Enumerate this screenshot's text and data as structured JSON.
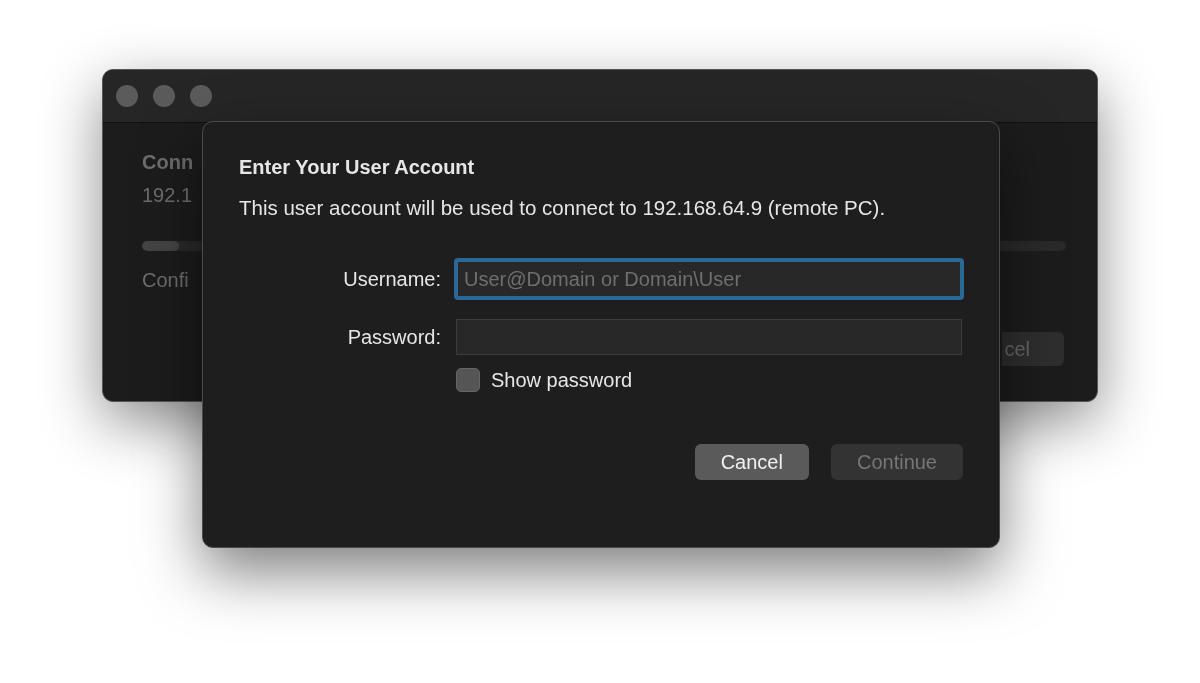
{
  "background_window": {
    "heading": "Conn",
    "subtitle": "192.1",
    "progress": {
      "level": 0.04
    },
    "status": "Confi",
    "button": "cel"
  },
  "dialog": {
    "title": "Enter Your User Account",
    "message": "This user account will be used to connect to 192.168.64.9 (remote PC).",
    "fields": [
      {
        "label": "Username:",
        "placeholder": "User@Domain or Domain\\User",
        "focused": true
      },
      {
        "label": "Password:",
        "focused": false
      }
    ],
    "show_password": {
      "label": "Show password",
      "checked": false
    },
    "buttons": [
      {
        "label": "Cancel",
        "disabled": false
      },
      {
        "label": "Continue",
        "disabled": true
      }
    ]
  }
}
